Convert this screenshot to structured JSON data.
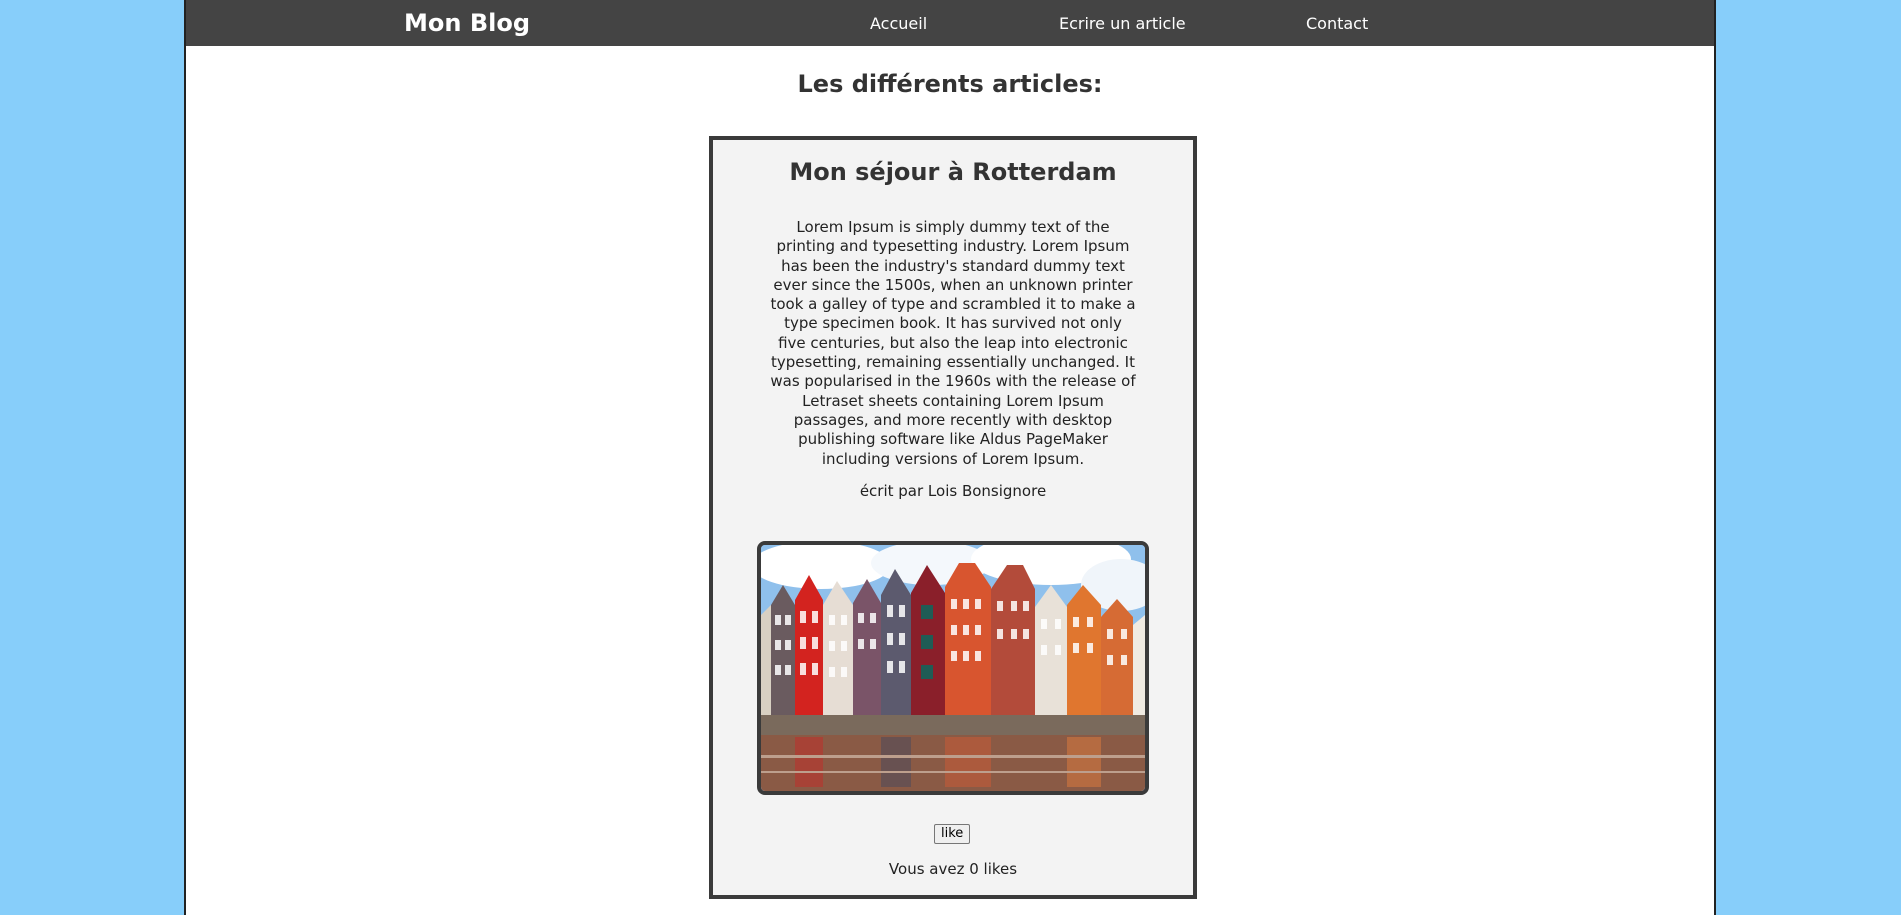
{
  "navbar": {
    "brand": "Mon Blog",
    "links": [
      {
        "label": "Accueil"
      },
      {
        "label": "Ecrire un article"
      },
      {
        "label": "Contact"
      }
    ]
  },
  "main": {
    "section_title": "Les différents articles:"
  },
  "article": {
    "title": "Mon séjour à Rotterdam",
    "body": "Lorem Ipsum is simply dummy text of the printing and typesetting industry. Lorem Ipsum has been the industry's standard dummy text ever since the 1500s, when an unknown printer took a galley of type and scrambled it to make a type specimen book. It has survived not only five centuries, but also the leap into electronic typesetting, remaining essentially unchanged. It was popularised in the 1960s with the release of Letraset sheets containing Lorem Ipsum passages, and more recently with desktop publishing software like Aldus PageMaker including versions of Lorem Ipsum.",
    "author": "écrit par Lois Bonsignore",
    "like_label": "like",
    "likes_text": "Vous avez 0 likes"
  },
  "colors": {
    "background": "#87cefa",
    "navbar": "#444444",
    "card": "#f3f3f3",
    "border": "#3a3a3a"
  }
}
